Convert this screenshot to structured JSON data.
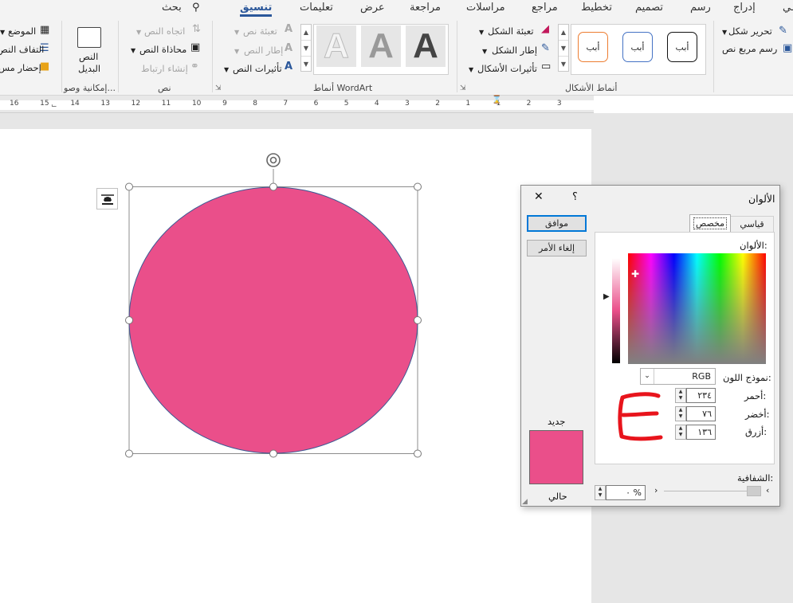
{
  "ribbon_tabs": [
    "بحث",
    "تنسيق",
    "تعليمات",
    "عرض",
    "مراجعة",
    "مراسلات",
    "مراجع",
    "تخطيط",
    "تصميم",
    "رسم",
    "إدراج",
    "ـي"
  ],
  "search_label": "بحث",
  "ribbon": {
    "insert_shapes": {
      "edit_shape": "تحرير شكل",
      "draw_textbox": "رسم مربع نص"
    },
    "shape_styles": {
      "label": "أنماط الأشكال",
      "sample_text": "أبب",
      "fill": "تعبئة الشكل",
      "outline": "إطار الشكل",
      "effects": "تأثيرات الأشكال"
    },
    "wordart": {
      "label": "أنماط WordArt",
      "letter": "A",
      "text_fill": "تعبئة نص",
      "text_outline": "إطار النص",
      "text_effects": "تأثيرات النص"
    },
    "text": {
      "label": "نص",
      "direction": "اتجاه النص",
      "align": "محاذاة النص",
      "create_link": "إنشاء ارتباط"
    },
    "accessibility": {
      "label": "إمكانية وصو...",
      "alt_text_line1": "النص",
      "alt_text_line2": "البديل"
    },
    "arrange": {
      "position": "الموضع",
      "wrap": "التفاف النص",
      "bring_forward": "إحضار مس"
    }
  },
  "ruler": {
    "numbers": [
      "16",
      "15",
      "14",
      "13",
      "12",
      "11",
      "10",
      "9",
      "8",
      "7",
      "6",
      "5",
      "4",
      "3",
      "2",
      "1",
      "1",
      "2",
      "3"
    ]
  },
  "shape": {
    "fill_color": "#ea4f8a",
    "outline_color": "#3c5a94"
  },
  "colors_dialog": {
    "title": "الألوان",
    "help": "؟",
    "close": "✕",
    "tabs": {
      "standard": "قياسي",
      "custom": "مخصص"
    },
    "ok": "موافق",
    "cancel": "إلغاء الأمر",
    "colors_label": "الألوان:",
    "color_model_label": "نموذج اللون:",
    "color_model_value": "RGB",
    "red_label": "أحمر:",
    "red_value": "٢٣٤",
    "green_label": "أخضر:",
    "green_value": "٧٦",
    "blue_label": "أزرق:",
    "blue_value": "١٣٦",
    "transparency_label": "الشفافية:",
    "transparency_value": "٠ %",
    "new_label": "جديد",
    "current_label": "حالي",
    "new_color": "#ea4f8a",
    "current_color": "#ea4f8a"
  },
  "annotation_color": "#e8141c"
}
